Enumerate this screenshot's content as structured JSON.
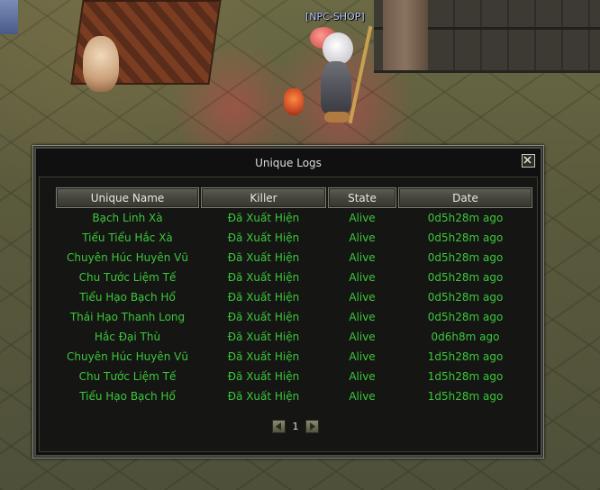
{
  "scene": {
    "npc_label": "[NPC-SHOP]"
  },
  "window": {
    "title": "Unique Logs",
    "close_icon": "close-icon"
  },
  "table": {
    "headers": [
      "Unique Name",
      "Killer",
      "State",
      "Date"
    ],
    "rows": [
      {
        "name": "Bạch Linh Xà",
        "killer": "Đã Xuất Hiện",
        "state": "Alive",
        "date": "0d5h28m ago"
      },
      {
        "name": "Tiểu Tiểu Hắc Xà",
        "killer": "Đã Xuất Hiện",
        "state": "Alive",
        "date": "0d5h28m ago"
      },
      {
        "name": "Chuyên Húc Huyên Vũ",
        "killer": "Đã Xuất Hiện",
        "state": "Alive",
        "date": "0d5h28m ago"
      },
      {
        "name": "Chu Tước Liệm Tế",
        "killer": "Đã Xuất Hiện",
        "state": "Alive",
        "date": "0d5h28m ago"
      },
      {
        "name": "Tiểu Hạo Bạch Hổ",
        "killer": "Đã Xuất Hiện",
        "state": "Alive",
        "date": "0d5h28m ago"
      },
      {
        "name": "Thái Hạo Thanh Long",
        "killer": "Đã Xuất Hiện",
        "state": "Alive",
        "date": "0d5h28m ago"
      },
      {
        "name": "Hắc Đại Thù",
        "killer": "Đã Xuất Hiện",
        "state": "Alive",
        "date": "0d6h8m ago"
      },
      {
        "name": "Chuyên Húc Huyên Vũ",
        "killer": "Đã Xuất Hiện",
        "state": "Alive",
        "date": "1d5h28m ago"
      },
      {
        "name": "Chu Tước Liệm Tế",
        "killer": "Đã Xuất Hiện",
        "state": "Alive",
        "date": "1d5h28m ago"
      },
      {
        "name": "Tiểu Hạo Bạch Hổ",
        "killer": "Đã Xuất Hiện",
        "state": "Alive",
        "date": "1d5h28m ago"
      }
    ]
  },
  "pager": {
    "page": "1",
    "prev_icon": "arrow-left-icon",
    "next_icon": "arrow-right-icon"
  },
  "colors": {
    "row_text": "#3bc83b",
    "header_text": "#e8e8e0"
  }
}
